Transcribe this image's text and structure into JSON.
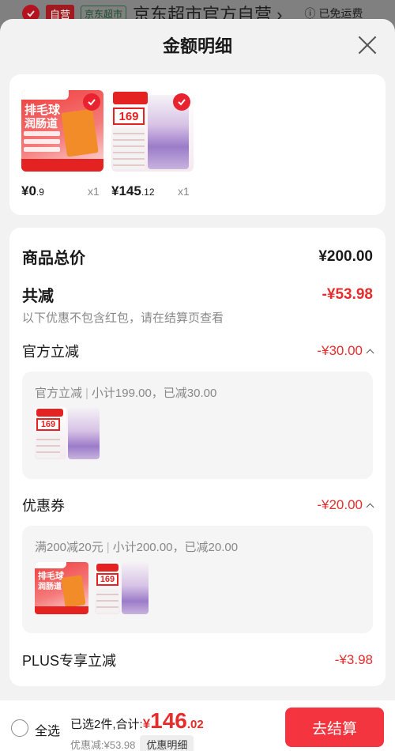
{
  "background": {
    "tag_self": "自营",
    "tag_green": "京东超市",
    "store_title": "京东超市官方自营",
    "store_arrow": "›",
    "free_shipping": "ⓘ 已免运费"
  },
  "sheet": {
    "title": "金额明细"
  },
  "products": [
    {
      "price_int": "¥0",
      "price_dec": ".9",
      "qty": "x1"
    },
    {
      "price_int": "¥145",
      "price_dec": ".12",
      "qty": "x1"
    }
  ],
  "summary": {
    "total_label": "商品总价",
    "total_value": "¥200.00",
    "reduce_label": "共减",
    "reduce_value": "-¥53.98",
    "note": "以下优惠不包含红包，请在结算页查看",
    "official": {
      "label": "官方立减",
      "value": "-¥30.00",
      "sub_name": "官方立减",
      "sub_detail": "小计199.00，已减30.00"
    },
    "coupon": {
      "label": "优惠券",
      "value": "-¥20.00",
      "sub_name": "满200减20元",
      "sub_detail": "小计200.00，已减20.00"
    },
    "plus": {
      "label": "PLUS专享立减",
      "value": "-¥3.98"
    }
  },
  "bottom": {
    "select_all": "全选",
    "selected_text": "已选2件,合计:",
    "yen": "¥",
    "total_int": "146",
    "total_dec": ".02",
    "discount_text": "优惠减:¥53.98",
    "detail_button": "优惠明细",
    "checkout_button": "去结算"
  },
  "colors": {
    "accent_red": "#e62c2c",
    "checkout_red": "#f5343f"
  }
}
